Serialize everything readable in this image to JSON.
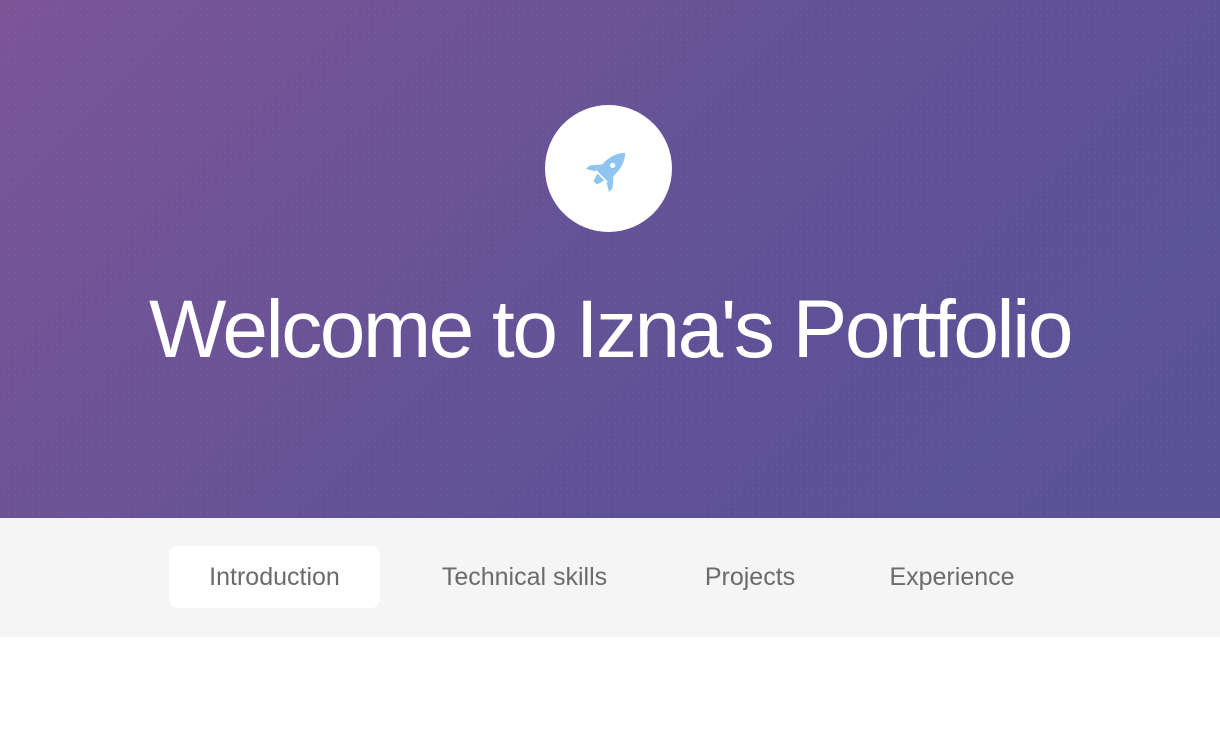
{
  "hero": {
    "title": "Welcome to Izna's Portfolio",
    "logo_icon": "rocket-icon",
    "logo_icon_color": "#8ec5ef",
    "gradient_colors": [
      "#7b5496",
      "#5a5295"
    ]
  },
  "nav": {
    "tabs": [
      {
        "label": "Introduction",
        "active": true
      },
      {
        "label": "Technical skills",
        "active": false
      },
      {
        "label": "Projects",
        "active": false
      },
      {
        "label": "Experience",
        "active": false
      }
    ]
  }
}
